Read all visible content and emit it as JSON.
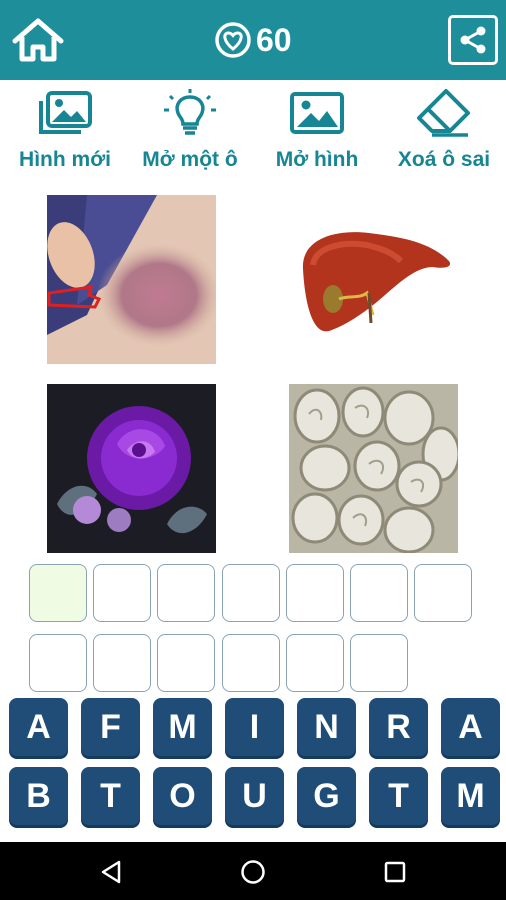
{
  "header": {
    "score": "60",
    "colors": {
      "bar": "#1e8e9a",
      "icon": "#ffffff"
    },
    "icons": {
      "home": "home-icon",
      "score": "heart-circle-icon",
      "share": "share-icon"
    }
  },
  "toolbar": {
    "items": [
      {
        "label": "Hình mới",
        "icon": "images-icon"
      },
      {
        "label": "Mở một ô",
        "icon": "lightbulb-icon"
      },
      {
        "label": "Mở hình",
        "icon": "image-icon"
      },
      {
        "label": "Xoá ô sai",
        "icon": "eraser-icon"
      }
    ],
    "color": "#178694"
  },
  "pictures": [
    {
      "name": "bruise-photo"
    },
    {
      "name": "liver-illustration"
    },
    {
      "name": "purple-rose-image"
    },
    {
      "name": "intestine-photo"
    }
  ],
  "answer": {
    "row1_slots": 7,
    "row2_slots": 6,
    "active_slot": 0,
    "colors": {
      "border": "#8aa3b3",
      "active_fill": "#f0fbe4"
    }
  },
  "keyboard": {
    "row1": [
      "A",
      "F",
      "M",
      "I",
      "N",
      "R",
      "A"
    ],
    "row2": [
      "B",
      "T",
      "O",
      "U",
      "G",
      "T",
      "M"
    ],
    "colors": {
      "key": "#1f4d78",
      "text": "#ffffff"
    }
  },
  "navbar": {
    "icons": [
      "back-icon",
      "home-circle-icon",
      "recents-icon"
    ]
  }
}
